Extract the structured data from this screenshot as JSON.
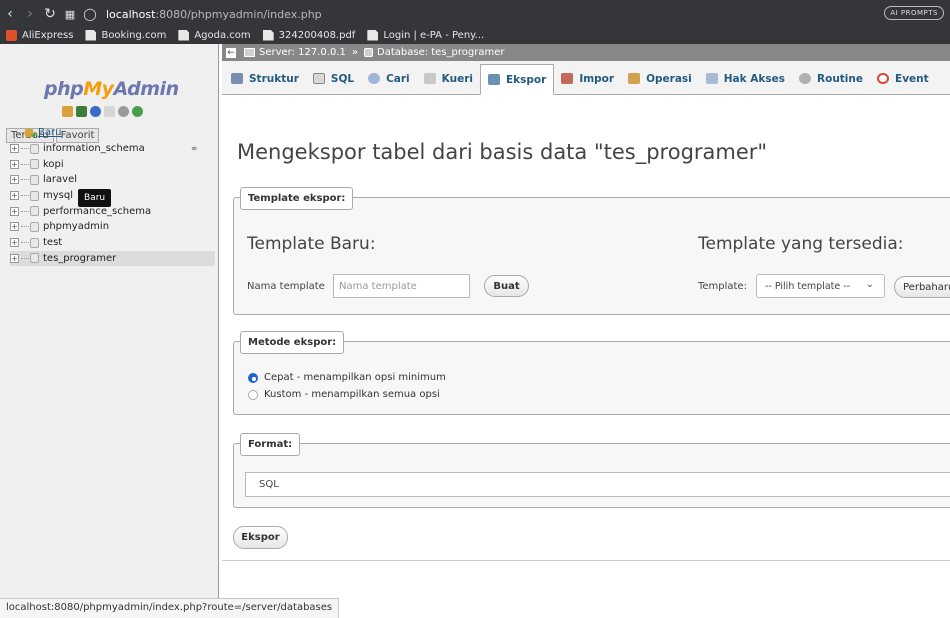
{
  "browser": {
    "url_host": "localhost",
    "url_rest": ":8080/phpmyadmin/index.php",
    "ai_prompts_label": "AI PROMPTS",
    "bookmarks": [
      {
        "label": "AliExpress",
        "icon": "aliexpress-icon"
      },
      {
        "label": "Booking.com",
        "icon": "document-icon"
      },
      {
        "label": "Agoda.com",
        "icon": "document-icon"
      },
      {
        "label": "324200408.pdf",
        "icon": "document-icon"
      },
      {
        "label": "Login | e-PA - Peny...",
        "icon": "document-icon"
      }
    ]
  },
  "nav": {
    "logo": {
      "php": "php",
      "my": "My",
      "admin": "Admin"
    },
    "tabs": [
      "Terbaru",
      "Favorit"
    ],
    "new_label": "Baru",
    "tooltip": "Baru",
    "databases": [
      {
        "name": "information_schema",
        "selected": false
      },
      {
        "name": "kopi",
        "selected": false
      },
      {
        "name": "laravel",
        "selected": false
      },
      {
        "name": "mysql",
        "selected": false
      },
      {
        "name": "performance_schema",
        "selected": false
      },
      {
        "name": "phpmyadmin",
        "selected": false
      },
      {
        "name": "test",
        "selected": false
      },
      {
        "name": "tes_programer",
        "selected": true
      }
    ]
  },
  "breadcrumb": {
    "server": "Server: 127.0.0.1",
    "separator": "»",
    "database": "Database: tes_programer"
  },
  "menu": {
    "tabs": [
      {
        "label": "Struktur",
        "icon": "structure-icon",
        "active": false
      },
      {
        "label": "SQL",
        "icon": "sql-icon",
        "active": false
      },
      {
        "label": "Cari",
        "icon": "search-icon",
        "active": false
      },
      {
        "label": "Kueri",
        "icon": "query-icon",
        "active": false
      },
      {
        "label": "Ekspor",
        "icon": "export-icon",
        "active": true
      },
      {
        "label": "Impor",
        "icon": "import-icon",
        "active": false
      },
      {
        "label": "Operasi",
        "icon": "wrench-icon",
        "active": false
      },
      {
        "label": "Hak Akses",
        "icon": "privileges-icon",
        "active": false
      },
      {
        "label": "Routine",
        "icon": "routine-icon",
        "active": false
      },
      {
        "label": "Event",
        "icon": "event-icon",
        "active": false
      }
    ]
  },
  "main": {
    "title": "Mengekspor tabel dari basis data \"tes_programer\"",
    "template": {
      "legend": "Template ekspor:",
      "new_heading": "Template Baru:",
      "existing_heading": "Template yang tersedia:",
      "name_label": "Nama template",
      "name_placeholder": "Nama template",
      "create_button": "Buat",
      "select_label": "Template:",
      "select_value": "-- Pilih template --",
      "refresh_button": "Perbaharui"
    },
    "method": {
      "legend": "Metode ekspor:",
      "options": [
        {
          "label": "Cepat - menampilkan opsi minimum",
          "checked": true
        },
        {
          "label": "Kustom - menampilkan semua opsi",
          "checked": false
        }
      ]
    },
    "format": {
      "legend": "Format:",
      "value": "SQL"
    },
    "export_button": "Ekspor"
  },
  "status_url": "localhost:8080/phpmyadmin/index.php?route=/server/databases",
  "colors": {
    "link": "#235a81",
    "logo_blue": "#6c78af",
    "logo_orange": "#f89c0e",
    "radio_on": "#1e66c9"
  }
}
